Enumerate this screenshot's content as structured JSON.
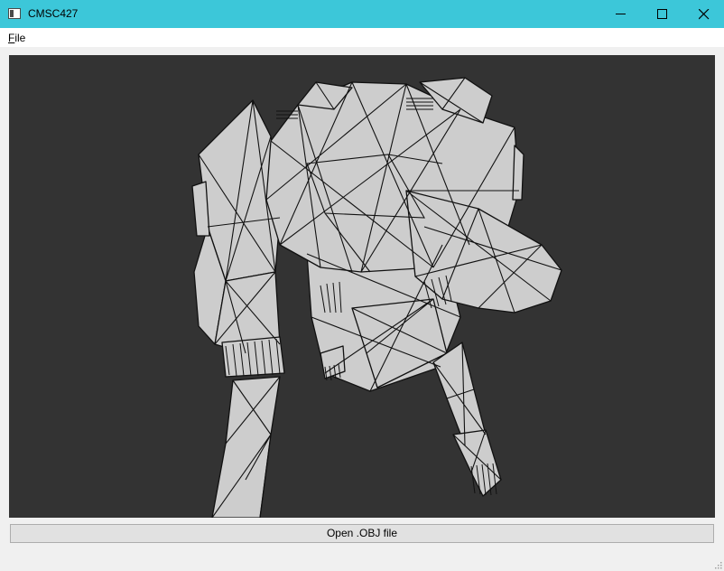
{
  "window": {
    "title": "CMSC427",
    "controls": [
      "minimize",
      "maximize",
      "close"
    ]
  },
  "menubar": {
    "items": [
      {
        "label": "File",
        "mnemonic": "F",
        "rest": "ile"
      }
    ]
  },
  "viewport": {
    "background": "#333333",
    "mesh_fill": "#cdcdcd",
    "mesh_stroke": "#111111"
  },
  "actions": {
    "open_label": "Open .OBJ file"
  },
  "colors": {
    "titlebar": "#3cc7d9",
    "window_bg": "#f0f0f0",
    "button_bg": "#e1e1e1"
  }
}
